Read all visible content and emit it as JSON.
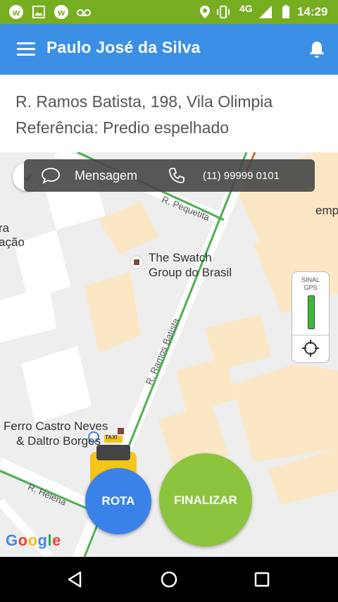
{
  "status_bar": {
    "time": "14:29",
    "network": "4G",
    "icons": [
      "waze-icon",
      "image-icon",
      "waze-icon",
      "voicemail-icon",
      "location-icon",
      "vibrate-icon",
      "signal-icon",
      "battery-icon"
    ]
  },
  "app_bar": {
    "title": "Paulo José da Silva",
    "icons": [
      "menu-icon",
      "bell-icon"
    ]
  },
  "address": {
    "street": "R. Ramos Batista, 198, Vila Olimpia",
    "reference": "Referência: Predio espelhado"
  },
  "message_bar": {
    "message_label": "Mensagem",
    "phone": "(11) 99999 0101"
  },
  "map": {
    "places": [
      {
        "line1": "The Swatch",
        "line2": "Group do Brasil"
      },
      {
        "line1": "Ferro Castro Neves",
        "line2": "& Daltro Borges"
      }
    ],
    "partial_labels": [
      "ra",
      "ação",
      "emp"
    ],
    "streets": [
      "R. Pequetita",
      "R. Ramos Batista",
      "R. Helena"
    ],
    "taxi_label": "TAXI",
    "attribution": "Google"
  },
  "gps_panel": {
    "label_line1": "SINAL",
    "label_line2": "GPS",
    "signal_level": 1.0
  },
  "actions": {
    "rota": "ROTA",
    "finalizar": "FINALIZAR"
  },
  "colors": {
    "status_bar": "#76ad21",
    "app_bar": "#3b8fe4",
    "rota": "#3b82e8",
    "finalizar": "#8cc43e",
    "route": "#4caf50"
  }
}
